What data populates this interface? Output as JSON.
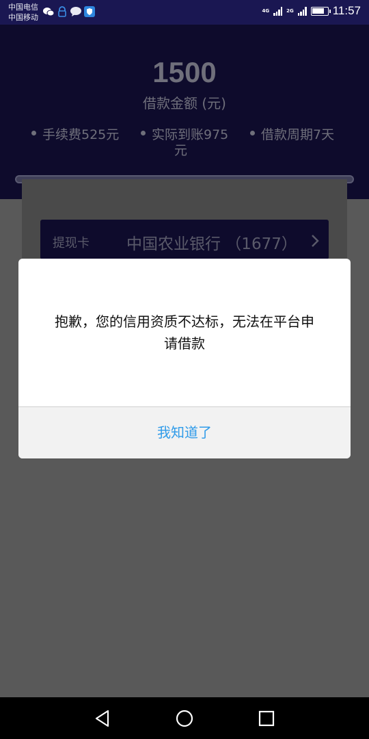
{
  "status_bar": {
    "carrier_1": "中国电信",
    "carrier_2": "中国移动",
    "net_1": "4G",
    "net_2": "2G",
    "time": "11:57"
  },
  "loan": {
    "amount": "1500",
    "amount_label": "借款金额 (元)",
    "fee": "手续费525元",
    "received": "实际到账975",
    "received_unit": "元",
    "period": "借款周期7天"
  },
  "card": {
    "label": "提现卡",
    "bank": "中国农业银行 （1677）"
  },
  "dialog": {
    "message": "抱歉，您的信用资质不达标，无法在平台申请借款",
    "confirm_label": "我知道了"
  },
  "colors": {
    "header_bg": "#0e0b2c",
    "status_bar_bg": "#1a1752",
    "accent": "#2f9be9"
  }
}
